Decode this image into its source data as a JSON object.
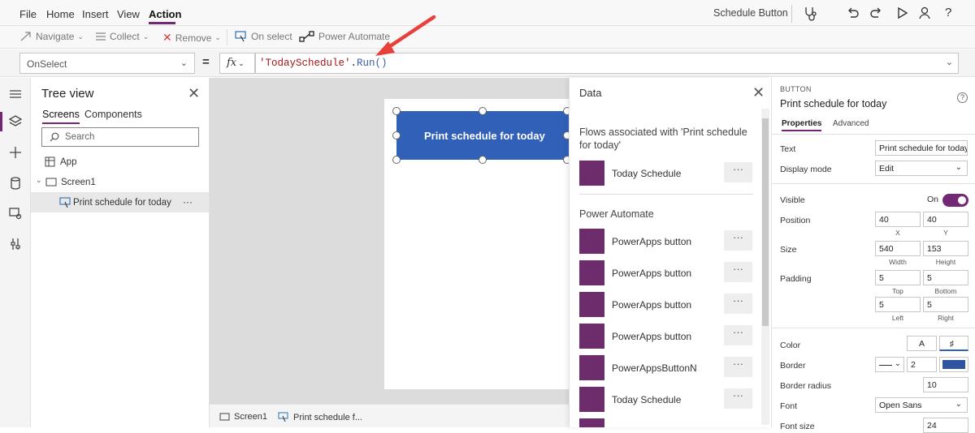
{
  "menu": {
    "items": [
      "File",
      "Home",
      "Insert",
      "View",
      "Action"
    ],
    "active": "Action",
    "app_title": "Schedule Button"
  },
  "toolbar": {
    "navigate": "Navigate",
    "collect": "Collect",
    "remove": "Remove",
    "on_select": "On select",
    "power_automate": "Power Automate"
  },
  "formula": {
    "property": "OnSelect",
    "equals": "=",
    "fx": "fx",
    "string_part": "'TodaySchedule'",
    "dot": ".",
    "func_part": "Run()"
  },
  "tree": {
    "title": "Tree view",
    "tabs": [
      "Screens",
      "Components"
    ],
    "search_placeholder": "Search",
    "app": "App",
    "screen": "Screen1",
    "control": "Print schedule for today",
    "more": "···"
  },
  "canvas": {
    "button_text": "Print schedule for today"
  },
  "statusbar": {
    "screen": "Screen1",
    "control": "Print schedule f..."
  },
  "data_panel": {
    "title": "Data",
    "flows_header": "Flows associated with 'Print schedule for today'",
    "associated_flows": [
      "Today Schedule"
    ],
    "power_automate_header": "Power Automate",
    "flows": [
      "PowerApps button",
      "PowerApps button",
      "PowerApps button",
      "PowerApps button",
      "PowerAppsButtonN",
      "Today Schedule"
    ],
    "more": "···"
  },
  "props": {
    "type": "BUTTON",
    "name": "Print schedule for today",
    "help": "?",
    "tabs": [
      "Properties",
      "Advanced"
    ],
    "text_label": "Text",
    "text_value": "Print schedule for today",
    "display_mode_label": "Display mode",
    "display_mode_value": "Edit",
    "visible_label": "Visible",
    "visible_value": "On",
    "position_label": "Position",
    "position_x": "40",
    "position_y": "40",
    "x_label": "X",
    "y_label": "Y",
    "size_label": "Size",
    "width": "540",
    "height": "153",
    "width_label": "Width",
    "height_label": "Height",
    "padding_label": "Padding",
    "pad_top": "5",
    "pad_bottom": "5",
    "pad_left": "5",
    "pad_right": "5",
    "top_label": "Top",
    "bottom_label": "Bottom",
    "left_label": "Left",
    "right_label": "Right",
    "color_label": "Color",
    "color_text": "A",
    "border_label": "Border",
    "border_width": "2",
    "border_radius_label": "Border radius",
    "border_radius": "10",
    "font_label": "Font",
    "font_value": "Open Sans",
    "font_size_label": "Font size",
    "font_size": "24"
  },
  "colors": {
    "accent": "#742774",
    "button_fill": "#3060b8",
    "flow_icon": "#6d2d6d",
    "arrow": "#e8413a"
  }
}
